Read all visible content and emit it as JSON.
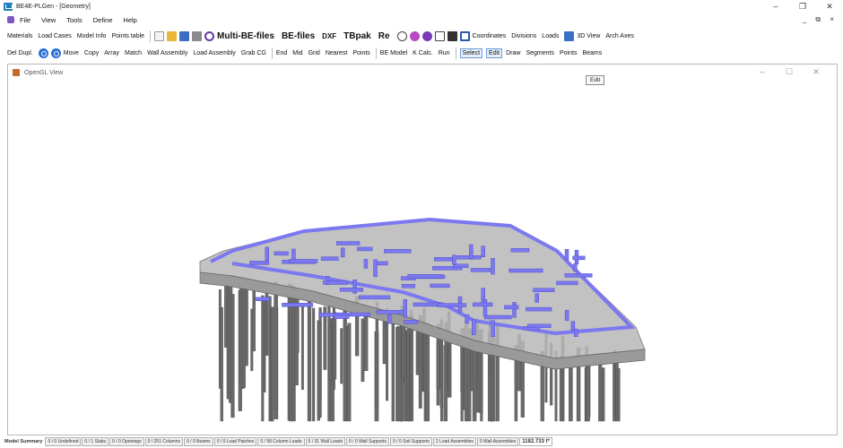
{
  "window": {
    "title": "BE4E-PLGen - [Geometry]",
    "controls": [
      "–",
      "❐",
      "✕"
    ]
  },
  "menubar": {
    "items": [
      "File",
      "View",
      "Tools",
      "Define",
      "Help"
    ],
    "mdi_controls": "_ ⧉ ×"
  },
  "toolbar1": {
    "text_buttons": [
      "Materials",
      "Load Cases",
      "Model Info",
      "Points table"
    ],
    "big_buttons": [
      "Multi-BE-files",
      "BE-files",
      "DXF",
      "TBpak",
      "Re"
    ],
    "right_buttons": [
      "Coordinates",
      "Divisions",
      "Loads",
      "3D View",
      "Arch Axes"
    ]
  },
  "toolbar2": {
    "group1": [
      "Del Dupl."
    ],
    "group2": [
      "Move",
      "Copy",
      "Array",
      "Match",
      "Wall Assembly",
      "Load Assembly",
      "Grab CG"
    ],
    "group3": [
      "End",
      "Mid",
      "Grid",
      "Nearest",
      "Points"
    ],
    "group4": [
      "BE Model",
      "K Calc.",
      "Run"
    ],
    "group5_active": [
      "Select",
      "Edit"
    ],
    "group5": [
      "Draw",
      "Segments",
      "Points",
      "Beams"
    ]
  },
  "tooltip": "Edit",
  "gl_window": {
    "title": "OpenGL View",
    "controls": [
      "–",
      "☐",
      "✕"
    ]
  },
  "statusbar": {
    "items": [
      "Model Summary",
      "0 / 0 Undefined",
      "0 / 1 Slabs",
      "0 / 0 Openings",
      "0 / 251 Columns",
      "0 / 0 Beams",
      "0 / 0 Load Patches",
      "0 / 58 Column Loads",
      "0 / 31 Wall Loads",
      "0 / 0 Wall Supports",
      "0 / 0 Soil Supports",
      "2 Load Assemblies",
      "0 Wall Assemblies",
      "1182.733 t*"
    ]
  },
  "colors": {
    "beam": "#7b78f0",
    "slab": "#b8b8b8",
    "column": "#6a6a6a"
  }
}
